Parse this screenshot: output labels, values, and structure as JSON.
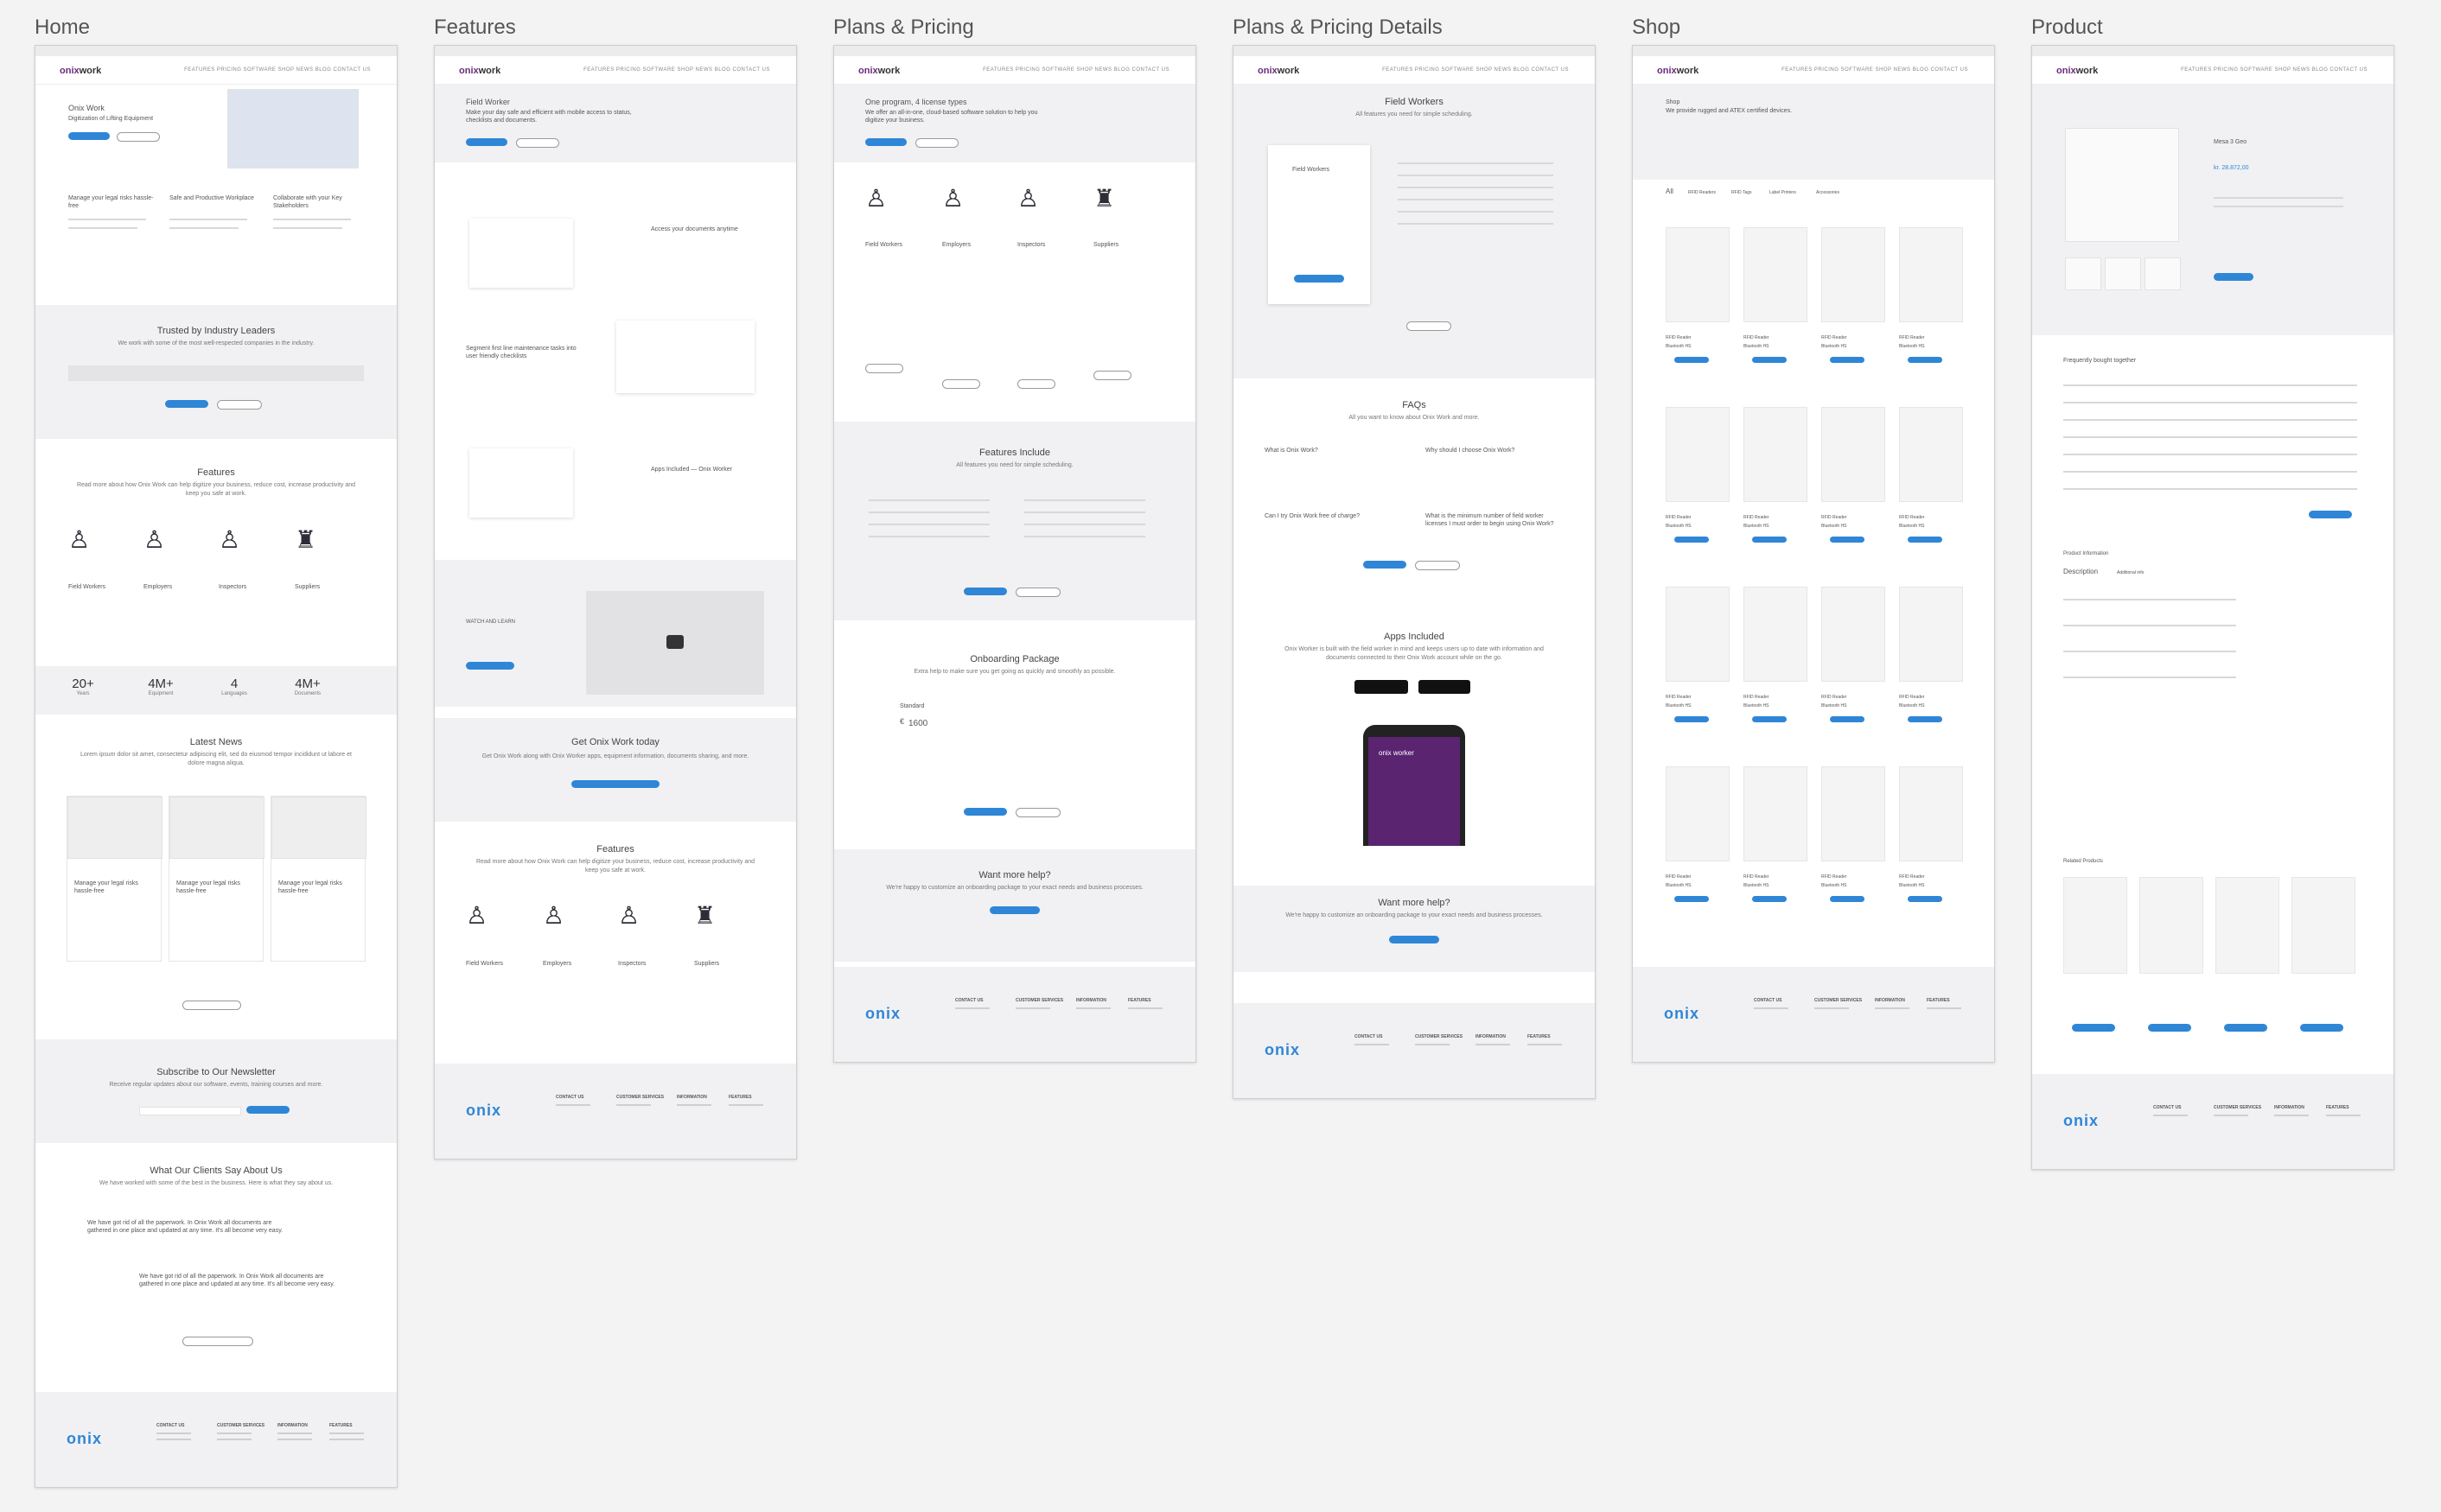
{
  "boards": {
    "home": "Home",
    "features": "Features",
    "plans": "Plans & Pricing",
    "details": "Plans & Pricing Details",
    "shop": "Shop",
    "product": "Product"
  },
  "brand": {
    "logo_a": "onix",
    "logo_b": "work",
    "footer_logo": "onix",
    "accent": "#2f86d6",
    "purple": "#6b2a7c"
  },
  "nav": "FEATURES   PRICING   SOFTWARE   SHOP   NEWS   BLOG   CONTACT US",
  "home": {
    "hero_title": "Onix Work",
    "hero_sub": "Digitization of Lifting Equipment",
    "cols": [
      "Manage your legal risks hassle-free",
      "Safe and Productive Workplace",
      "Collaborate with your Key Stakeholders"
    ],
    "trusted_title": "Trusted by Industry Leaders",
    "trusted_sub": "We work with some of the most well-respected companies in the industry.",
    "features_title": "Features",
    "features_sub": "Read more about how Onix Work can help digitize your business, reduce cost, increase productivity and keep you safe at work.",
    "roles": [
      "Field Workers",
      "Employers",
      "Inspectors",
      "Suppliers"
    ],
    "stats": [
      {
        "n": "20+",
        "c": "Years"
      },
      {
        "n": "4M+",
        "c": "Equipment"
      },
      {
        "n": "4",
        "c": "Languages"
      },
      {
        "n": "4M+",
        "c": "Documents"
      }
    ],
    "news_title": "Latest News",
    "news_sub": "Lorem ipsum dolor sit amet, consectetur adipiscing elit, sed do eiusmod tempor incididunt ut labore et dolore magna aliqua.",
    "news_card_title": "Manage your legal risks hassle-free",
    "newsletter_title": "Subscribe to Our Newsletter",
    "newsletter_sub": "Receive regular updates about our software, events, training courses and more.",
    "clients_title": "What Our Clients Say About Us",
    "clients_sub": "We have worked with some of the best in the business. Here is what they say about us.",
    "quote": "We have got rid of all the paperwork. In Onix Work all documents are gathered in one place and updated at any time. It's all become very easy."
  },
  "features": {
    "hero_title": "Field Worker",
    "hero_sub": "Make your day safe and efficient with mobile access to status, checklists and documents.",
    "blocks": [
      "Access your documents anytime",
      "Segment first line maintenance tasks into user friendly checklists",
      "Apps Included — Onix Worker"
    ],
    "watch": "WATCH AND LEARN",
    "cta_title": "Get Onix Work today",
    "cta_sub": "Get Onix Work along with Onix Worker apps, equipment information, documents sharing, and more.",
    "features_title": "Features",
    "features_sub": "Read more about how Onix Work can help digitize your business, reduce cost, increase productivity and keep you safe at work.",
    "roles": [
      "Field Workers",
      "Employers",
      "Inspectors",
      "Suppliers"
    ]
  },
  "plans": {
    "hero_title": "One program, 4 license types",
    "hero_sub": "We offer an all-in-one, cloud-based software solution to help you digitize your business.",
    "roles": [
      "Field Workers",
      "Employers",
      "Inspectors",
      "Suppliers"
    ],
    "include_title": "Features Include",
    "include_sub": "All features you need for simple scheduling.",
    "onboard_title": "Onboarding Package",
    "onboard_sub": "Extra help to make sure you get going as quickly and smoothly as possible.",
    "standard": "Standard",
    "price": "1600",
    "currency": "€",
    "help_title": "Want more help?",
    "help_sub": "We're happy to customize an onboarding package to your exact needs and business processes."
  },
  "details": {
    "hero_title": "Field Workers",
    "hero_sub": "All features you need for simple scheduling.",
    "card_title": "Field Workers",
    "faq_title": "FAQs",
    "faq_sub": "All you want to know about Onix Work and more.",
    "faq_q": [
      "What is Onix Work?",
      "Why should I choose Onix Work?",
      "Can I try Onix Work free of charge?",
      "What is the minimum number of field worker licenses I must order to begin using Onix Work?"
    ],
    "apps_title": "Apps Included",
    "apps_sub": "Onix Worker is built with the field worker in mind and keeps users up to date with information and documents connected to their Onix Work account while on the go.",
    "phone_logo": "onix worker",
    "help_title": "Want more help?",
    "help_sub": "We're happy to customize an onboarding package to your exact needs and business processes."
  },
  "shop": {
    "title": "Shop",
    "sub": "We provide rugged and ATEX certified devices.",
    "tabs": [
      "All",
      "RFID Readers",
      "RFID Tags",
      "Label Printers",
      "Accessories"
    ],
    "product_name": "RFID Reader",
    "product_sub": "Bluetooth HS"
  },
  "product": {
    "title": "Mesa 3 Geo",
    "price": "kr. 28.872,00",
    "bought_title": "Frequently bought together",
    "info_title": "Product Information",
    "desc_tab": "Description",
    "info_tab": "Additional info",
    "related_title": "Related Products"
  }
}
